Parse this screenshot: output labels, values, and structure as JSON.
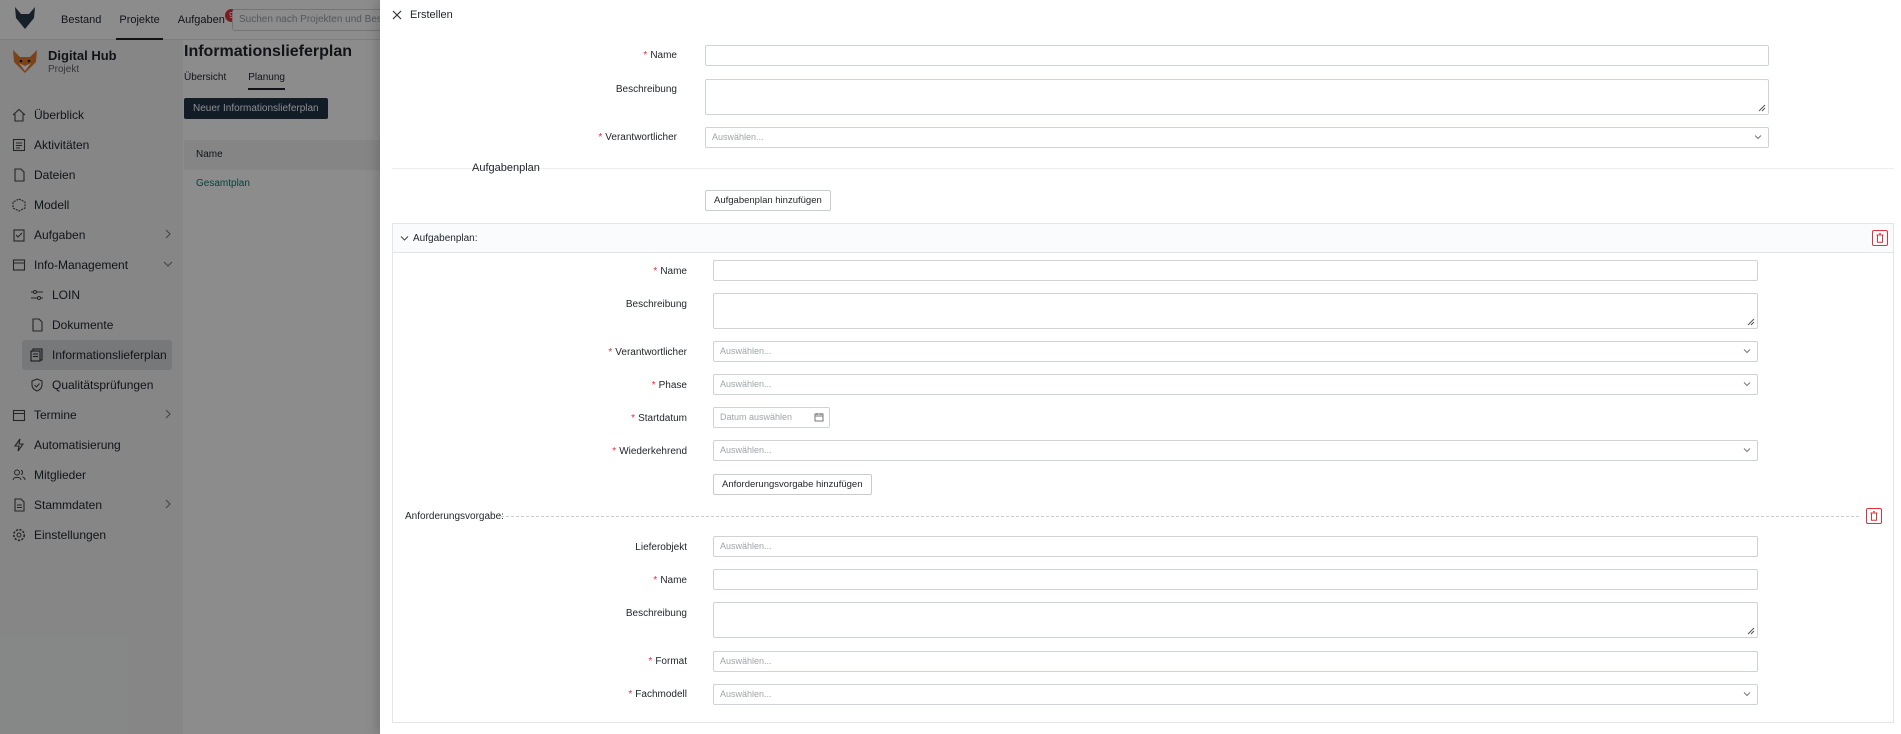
{
  "topbar": {
    "nav": [
      "Bestand",
      "Projekte",
      "Aufgaben"
    ],
    "active": "Projekte",
    "tasks_badge": "9",
    "search_placeholder": "Suchen nach Projekten und Bestand"
  },
  "project": {
    "title": "Digital Hub",
    "subtitle": "Projekt"
  },
  "sidebar": {
    "items": [
      {
        "label": "Überblick",
        "icon": "home-icon"
      },
      {
        "label": "Aktivitäten",
        "icon": "activity-icon"
      },
      {
        "label": "Dateien",
        "icon": "file-icon"
      },
      {
        "label": "Modell",
        "icon": "cube-icon"
      },
      {
        "label": "Aufgaben",
        "icon": "tasks-icon",
        "chevron": "right"
      },
      {
        "label": "Info-Management",
        "icon": "info-management-icon",
        "chevron": "down"
      },
      {
        "label": "LOIN",
        "icon": "sliders-icon",
        "sub": true
      },
      {
        "label": "Dokumente",
        "icon": "document-icon",
        "sub": true
      },
      {
        "label": "Informationslieferplan",
        "icon": "delivery-plan-icon",
        "sub": true,
        "active": true
      },
      {
        "label": "Qualitätsprüfungen",
        "icon": "shield-check-icon",
        "sub": true
      },
      {
        "label": "Termine",
        "icon": "calendar-icon",
        "chevron": "right"
      },
      {
        "label": "Automatisierung",
        "icon": "lightning-icon"
      },
      {
        "label": "Mitglieder",
        "icon": "users-icon"
      },
      {
        "label": "Stammdaten",
        "icon": "database-icon",
        "chevron": "right"
      },
      {
        "label": "Einstellungen",
        "icon": "gear-icon"
      }
    ]
  },
  "main": {
    "title": "Informationslieferplan",
    "tabs": [
      "Übersicht",
      "Planung"
    ],
    "active_tab": "Planung",
    "new_button": "Neuer Informationslieferplan",
    "table": {
      "header": "Name",
      "rows": [
        "Gesamtplan"
      ]
    }
  },
  "drawer": {
    "title": "Erstellen",
    "form": {
      "name_label": "Name",
      "description_label": "Beschreibung",
      "responsible_label": "Verantwortlicher",
      "responsible_placeholder": "Auswählen..."
    },
    "section_title": "Aufgabenplan",
    "add_taskplan_button": "Aufgabenplan hinzufügen",
    "taskplan": {
      "header": "Aufgabenplan:",
      "name_label": "Name",
      "description_label": "Beschreibung",
      "responsible_label": "Verantwortlicher",
      "responsible_placeholder": "Auswählen...",
      "phase_label": "Phase",
      "phase_placeholder": "Auswählen...",
      "startdate_label": "Startdatum",
      "startdate_placeholder": "Datum auswählen",
      "recurring_label": "Wiederkehrend",
      "recurring_placeholder": "Auswählen...",
      "add_requirement_button": "Anforderungsvorgabe hinzufügen"
    },
    "requirement": {
      "header": "Anforderungsvorgabe:",
      "deliverable_label": "Lieferobjekt",
      "deliverable_placeholder": "Auswählen...",
      "name_label": "Name",
      "description_label": "Beschreibung",
      "format_label": "Format",
      "format_placeholder": "Auswählen...",
      "discipline_model_label": "Fachmodell",
      "discipline_model_placeholder": "Auswählen..."
    }
  },
  "colors": {
    "required": "#e0303a",
    "primary_button": "#1f3447",
    "link": "#0a7a6a"
  }
}
